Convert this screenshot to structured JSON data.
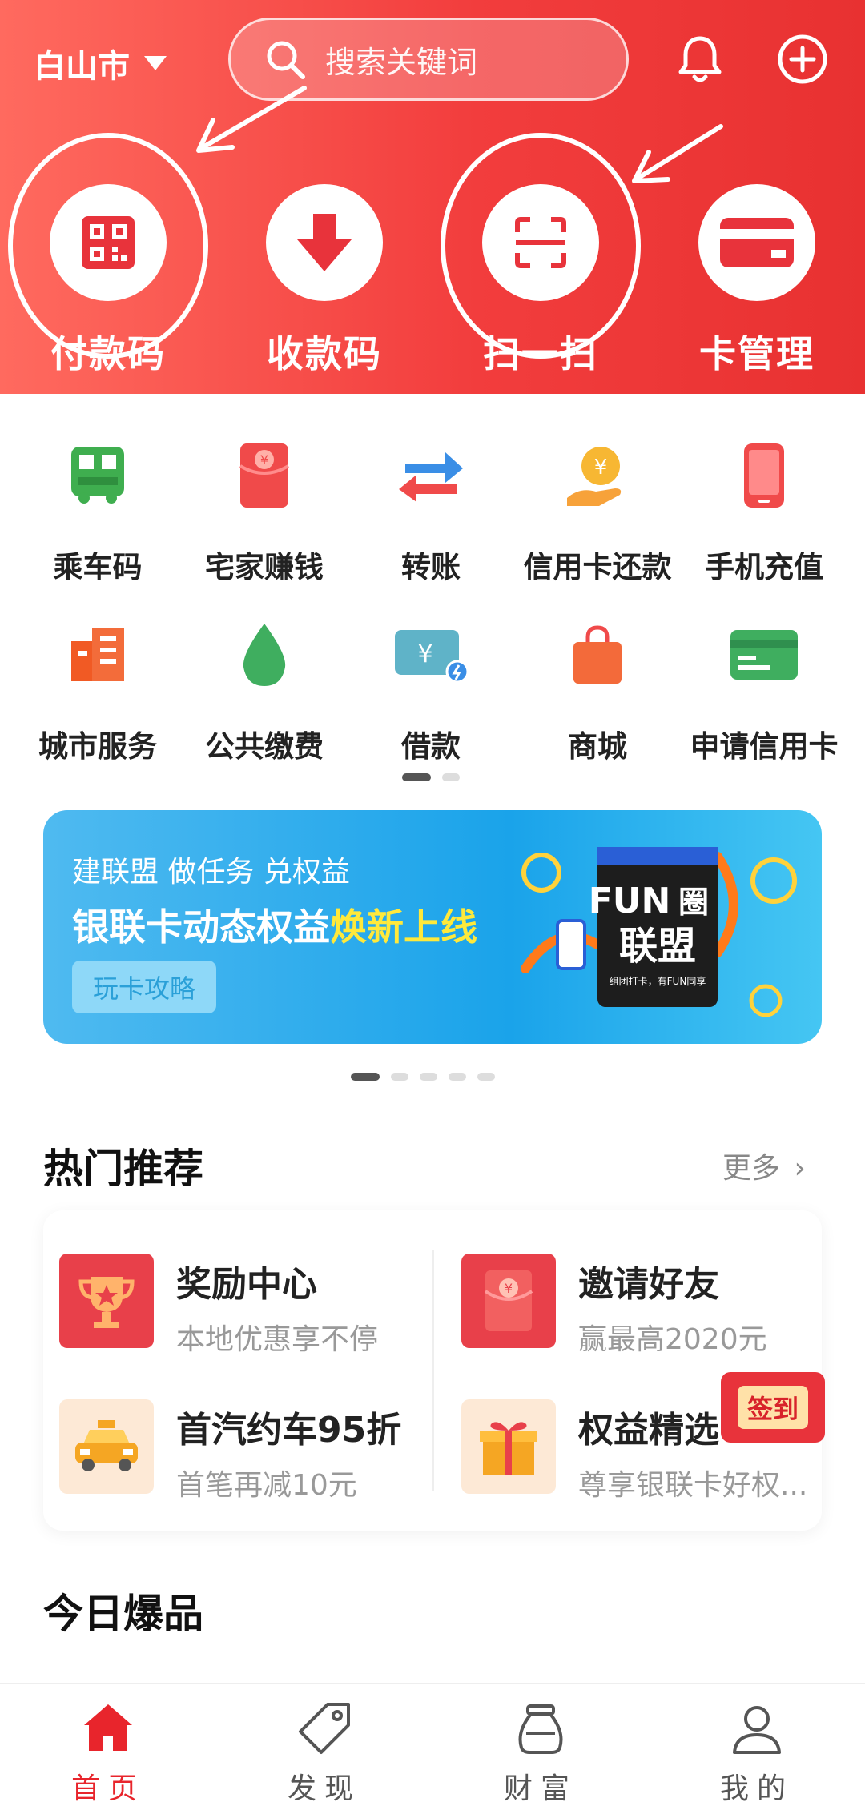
{
  "header": {
    "city": "白山市",
    "search_placeholder": "搜索关键词"
  },
  "quick_actions": [
    {
      "label": "付款码",
      "icon": "qr-code-icon"
    },
    {
      "label": "收款码",
      "icon": "download-arrow-icon"
    },
    {
      "label": "扫一扫",
      "icon": "scan-icon"
    },
    {
      "label": "卡管理",
      "icon": "card-icon"
    }
  ],
  "services": [
    {
      "label": "乘车码",
      "icon": "bus-icon"
    },
    {
      "label": "宅家赚钱",
      "icon": "red-envelope-icon"
    },
    {
      "label": "转账",
      "icon": "transfer-icon"
    },
    {
      "label": "信用卡还款",
      "icon": "coin-hand-icon"
    },
    {
      "label": "手机充值",
      "icon": "phone-icon"
    },
    {
      "label": "城市服务",
      "icon": "building-icon"
    },
    {
      "label": "公共缴费",
      "icon": "water-drop-icon"
    },
    {
      "label": "借款",
      "icon": "loan-card-icon"
    },
    {
      "label": "商城",
      "icon": "shopping-bag-icon"
    },
    {
      "label": "申请信用卡",
      "icon": "credit-card-icon"
    }
  ],
  "banner": {
    "sub": "建联盟 做任务 兑权益",
    "main_prefix": "银联卡动态权益",
    "main_highlight": "焕新上线",
    "button": "玩卡攻略",
    "art_title_1": "FUN",
    "art_title_2": "圈",
    "art_title_3": "联盟",
    "art_caption": "组团打卡，有FUN同享"
  },
  "hot": {
    "title": "热门推荐",
    "more": "更多",
    "items": [
      {
        "title": "奖励中心",
        "desc": "本地优惠享不停",
        "icon": "trophy-icon"
      },
      {
        "title": "邀请好友",
        "desc": "赢最高2020元",
        "icon": "red-envelope-icon"
      },
      {
        "title": "首汽约车95折",
        "desc": "首笔再减10元",
        "icon": "taxi-icon"
      },
      {
        "title": "权益精选",
        "desc": "尊享银联卡好权...",
        "icon": "gift-icon"
      }
    ]
  },
  "signin": "签到",
  "today": {
    "title": "今日爆品"
  },
  "tabs": [
    {
      "label": "首页",
      "icon": "home-icon",
      "active": true
    },
    {
      "label": "发现",
      "icon": "tag-icon",
      "active": false
    },
    {
      "label": "财富",
      "icon": "money-bag-icon",
      "active": false
    },
    {
      "label": "我的",
      "icon": "user-icon",
      "active": false
    }
  ],
  "colors": {
    "brand_red": "#e83131",
    "tab_active": "#e8252c",
    "tab_inactive": "#555555"
  }
}
